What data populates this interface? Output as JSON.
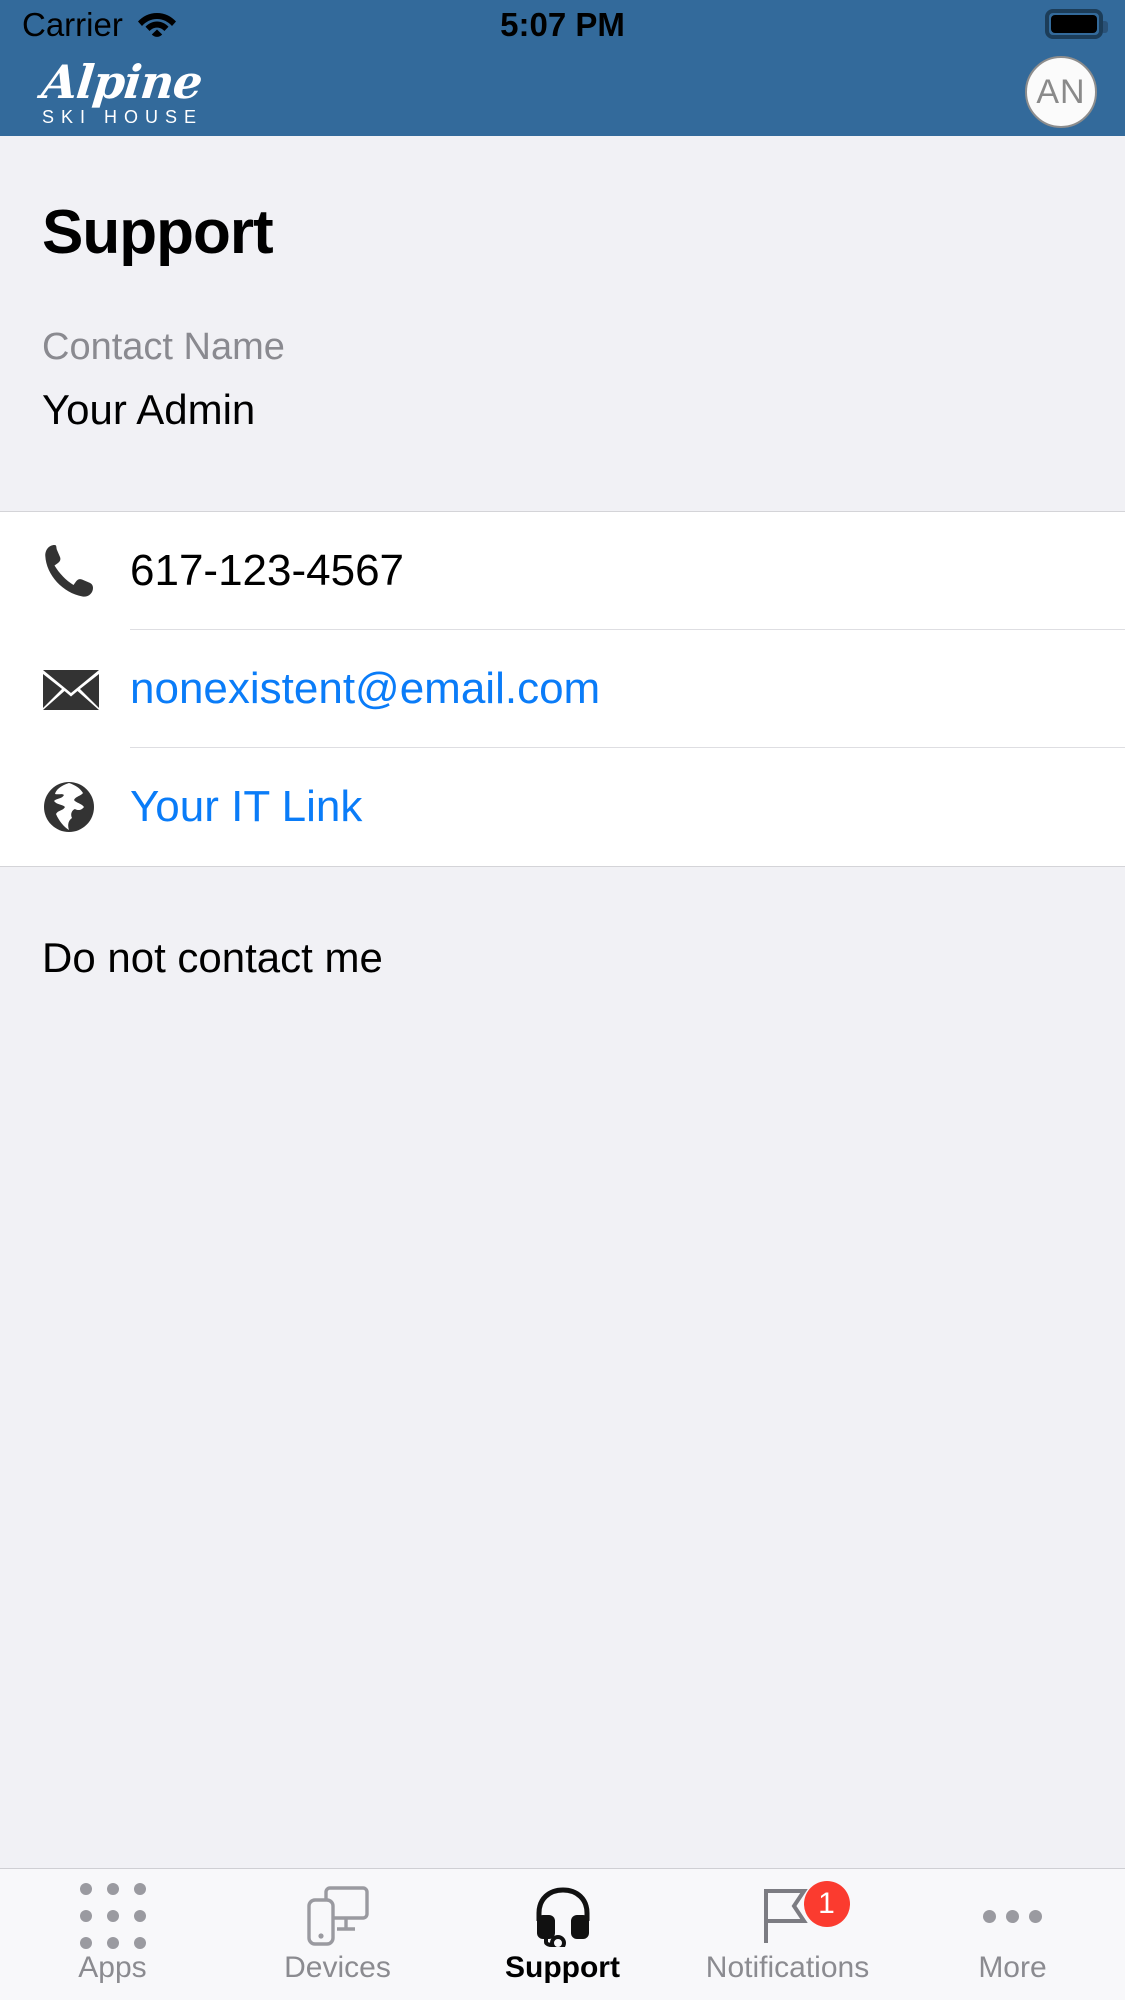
{
  "status_bar": {
    "carrier": "Carrier",
    "time": "5:07 PM",
    "wifi_icon": "wifi-icon",
    "battery_icon": "battery-full-icon"
  },
  "nav_bar": {
    "brand_script": "Alpine",
    "brand_sub": "SKI HOUSE",
    "avatar_initials": "AN"
  },
  "page": {
    "title": "Support",
    "contact_name_label": "Contact Name",
    "contact_name_value": "Your Admin",
    "do_not_contact_label": "Do not contact me"
  },
  "contact_rows": [
    {
      "icon": "phone-icon",
      "text": "617-123-4567",
      "is_link": false
    },
    {
      "icon": "envelope-icon",
      "text": "nonexistent@email.com",
      "is_link": true
    },
    {
      "icon": "globe-icon",
      "text": "Your IT Link",
      "is_link": true
    }
  ],
  "tabs": [
    {
      "label": "Apps",
      "icon": "apps-grid-icon",
      "active": false,
      "badge": ""
    },
    {
      "label": "Devices",
      "icon": "devices-icon",
      "active": false,
      "badge": ""
    },
    {
      "label": "Support",
      "icon": "headset-icon",
      "active": true,
      "badge": ""
    },
    {
      "label": "Notifications",
      "icon": "flag-icon",
      "active": false,
      "badge": "1"
    },
    {
      "label": "More",
      "icon": "ellipsis-icon",
      "active": false,
      "badge": ""
    }
  ],
  "colors": {
    "brand_blue": "#336a9b",
    "page_background": "#f1f1f5",
    "card_background": "#ffffff",
    "link_blue": "#0a7cf8",
    "badge_red": "#fb3b2f",
    "muted_gray": "#8a8a90"
  }
}
